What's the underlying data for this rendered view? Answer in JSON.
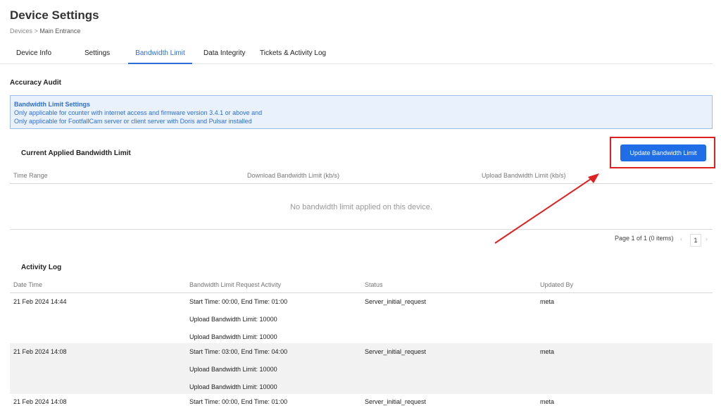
{
  "header": {
    "title": "Device Settings",
    "breadcrumb_root": "Devices",
    "breadcrumb_sep": ">",
    "breadcrumb_current": "Main Entrance"
  },
  "tabs": [
    {
      "label": "Device Info",
      "active": false
    },
    {
      "label": "Settings",
      "active": false
    },
    {
      "label": "Bandwidth Limit",
      "active": true
    },
    {
      "label": "Data Integrity",
      "active": false
    },
    {
      "label": "Tickets & Activity Log",
      "active": false
    }
  ],
  "section_accuracy": "Accuracy Audit",
  "info": {
    "title": "Bandwidth Limit Settings",
    "line1": "Only applicable for counter with internet access and firmware version 3.4.1 or above and",
    "line2": "Only applicable for FootfallCam server or client server with Doris and Pulsar installed"
  },
  "current": {
    "title": "Current Applied Bandwidth Limit",
    "button_label": "Update Bandwidth Limit",
    "columns": [
      "Time Range",
      "Download Bandwidth Limit (kb/s)",
      "Upload Bandwidth Limit (kb/s)"
    ],
    "empty_message": "No bandwidth limit applied on this device."
  },
  "pager": {
    "summary": "Page 1 of 1 (0 items)",
    "prev": "‹",
    "page": "1",
    "next": "›"
  },
  "activity": {
    "title": "Activity Log",
    "columns": [
      "Date Time",
      "Bandwidth Limit Request Activity",
      "Status",
      "Updated By"
    ],
    "rows": [
      {
        "date": "21 Feb 2024 14:44",
        "lines": [
          "Start Time: 00:00, End Time: 01:00",
          "Upload Bandwidth Limit: 10000",
          "Upload Bandwidth Limit: 10000"
        ],
        "status": "Server_initial_request",
        "by": "meta"
      },
      {
        "date": "21 Feb 2024 14:08",
        "lines": [
          "Start Time: 03:00, End Time: 04:00",
          "Upload Bandwidth Limit: 10000",
          "Upload Bandwidth Limit: 10000"
        ],
        "status": "Server_initial_request",
        "by": "meta"
      },
      {
        "date": "21 Feb 2024 14:08",
        "lines": [
          "Start Time: 00:00, End Time: 01:00"
        ],
        "status": "Server_initial_request",
        "by": "meta"
      }
    ]
  },
  "colors": {
    "accent": "#1f6ee8",
    "annotation": "#e02020",
    "info_bg": "#e8f1fc"
  }
}
